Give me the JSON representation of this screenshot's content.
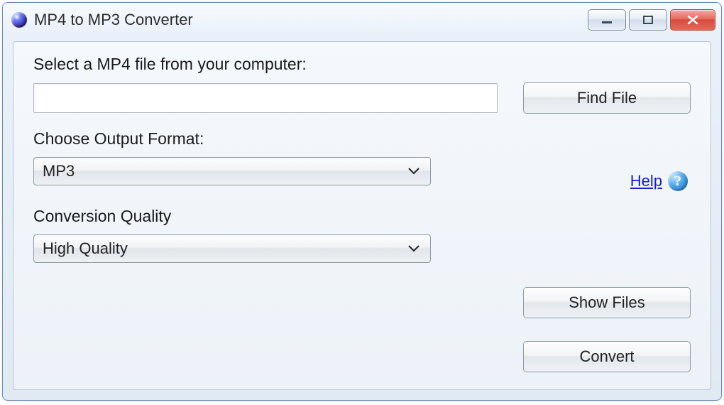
{
  "titlebar": {
    "title": "MP4 to MP3 Converter"
  },
  "labels": {
    "select_file": "Select a MP4 file from your computer:",
    "output_format": "Choose Output Format:",
    "quality": "Conversion Quality"
  },
  "inputs": {
    "file_path": ""
  },
  "selects": {
    "format_value": "MP3",
    "quality_value": "High Quality"
  },
  "buttons": {
    "find_file": "Find File",
    "show_files": "Show Files",
    "convert": "Convert"
  },
  "help": {
    "label": "Help",
    "icon_glyph": "?"
  }
}
